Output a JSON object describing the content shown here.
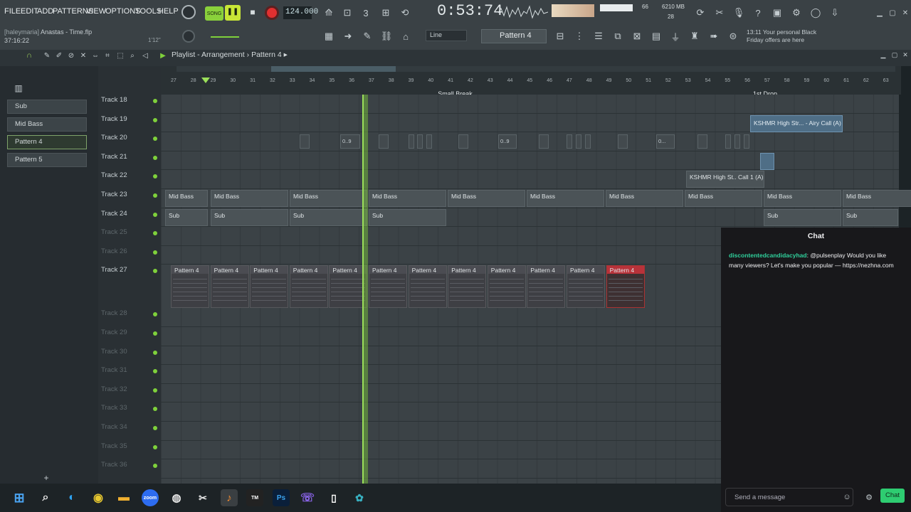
{
  "menu": [
    "FILE",
    "EDIT",
    "ADD",
    "PATTERNS",
    "VIEW",
    "OPTIONS",
    "TOOLS",
    "HELP"
  ],
  "transport": {
    "mode": "SONG",
    "bpm": "124.000",
    "time": "0:53:74",
    "cpu": "66",
    "ram": "6210 MB",
    "poly": "28",
    "pattern_selector": "Pattern 4",
    "snap": "Line"
  },
  "file": {
    "user": "[haleymaria]",
    "name": "Anastas - Time.flp",
    "elapsed": "37:16:22",
    "hint": "1'12\""
  },
  "promo": {
    "time": "13:11",
    "line1": "Your personal Black",
    "line2": "Friday offers are here"
  },
  "playlist": {
    "title": "Playlist - Arrangement",
    "sep": "›",
    "pattern": "Pattern 4"
  },
  "picker": [
    "Sub",
    "Mid Bass",
    "Pattern 4",
    "Pattern 5"
  ],
  "ruler": {
    "numbers": [
      "27",
      "28",
      "29",
      "30",
      "31",
      "32",
      "33",
      "34",
      "35",
      "36",
      "37",
      "38",
      "39",
      "40",
      "41",
      "42",
      "43",
      "44",
      "45",
      "46",
      "47",
      "48",
      "49",
      "50",
      "51",
      "52",
      "53",
      "54",
      "55",
      "56",
      "57",
      "58",
      "59",
      "60",
      "61",
      "62",
      "63"
    ],
    "markers": [
      {
        "label": "Small Break",
        "bar": "41"
      },
      {
        "label": "1st Drop",
        "bar": "57"
      }
    ]
  },
  "tracks": [
    {
      "name": "Track 18",
      "dim": false
    },
    {
      "name": "Track 19",
      "dim": false
    },
    {
      "name": "Track 20",
      "dim": false
    },
    {
      "name": "Track 21",
      "dim": false
    },
    {
      "name": "Track 22",
      "dim": false
    },
    {
      "name": "Track 23",
      "dim": false
    },
    {
      "name": "Track 24",
      "dim": false
    },
    {
      "name": "Track 25",
      "dim": true
    },
    {
      "name": "Track 26",
      "dim": true
    },
    {
      "name": "Track 27",
      "dim": false
    },
    {
      "name": "Track 28",
      "dim": true
    },
    {
      "name": "Track 29",
      "dim": true
    },
    {
      "name": "Track 30",
      "dim": true
    },
    {
      "name": "Track 31",
      "dim": true
    },
    {
      "name": "Track 32",
      "dim": true
    },
    {
      "name": "Track 33",
      "dim": true
    },
    {
      "name": "Track 34",
      "dim": true
    },
    {
      "name": "Track 35",
      "dim": true
    },
    {
      "name": "Track 36",
      "dim": true
    }
  ],
  "clips": {
    "midbass": "Mid Bass",
    "sub": "Sub",
    "airy": "KSHMR High Str... - Airy Call (A)",
    "call": "KSHMR High St.. Call 1 (A)",
    "pattern": "Pattern 4",
    "slice_label": "0..9",
    "slice_label2": "0...",
    "slice_icon": "⊶"
  },
  "chat": {
    "title": "Chat",
    "user": "discontentedcandidacyhad",
    "text": ": @pulsenplay Would you like many viewers? Let's make you popular — https://nezhna.com",
    "input_placeholder": "Send a message",
    "button": "Chat"
  },
  "colors": {
    "playhead": "#9be05a",
    "chat_user": "#2fcf9b",
    "pattern_red": "#b8323a"
  }
}
